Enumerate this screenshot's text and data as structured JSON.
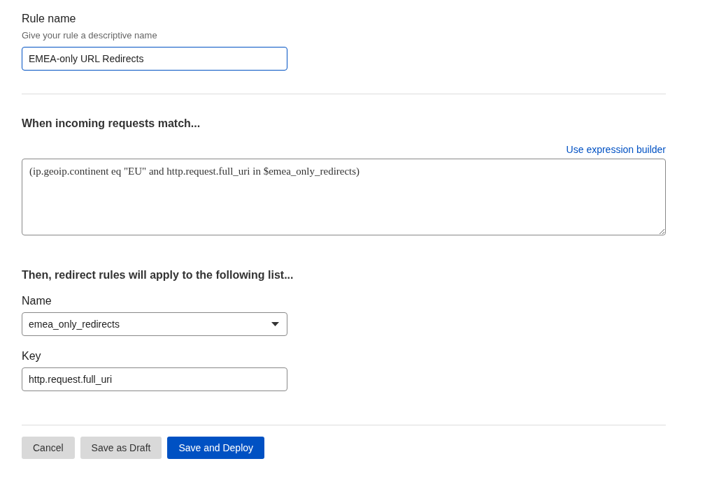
{
  "rule_name": {
    "label": "Rule name",
    "hint": "Give your rule a descriptive name",
    "value": "EMEA-only URL Redirects",
    "focused": true
  },
  "match": {
    "heading": "When incoming requests match...",
    "builder_link": "Use expression builder",
    "expression": "(ip.geoip.continent eq \"EU\" and http.request.full_uri in $emea_only_redirects)"
  },
  "list": {
    "heading": "Then, redirect rules will apply to the following list...",
    "name_label": "Name",
    "name_value": "emea_only_redirects",
    "key_label": "Key",
    "key_value": "http.request.full_uri"
  },
  "buttons": [
    {
      "label": "Cancel",
      "kind": "secondary"
    },
    {
      "label": "Save as Draft",
      "kind": "secondary"
    },
    {
      "label": "Save and Deploy",
      "kind": "primary"
    }
  ]
}
